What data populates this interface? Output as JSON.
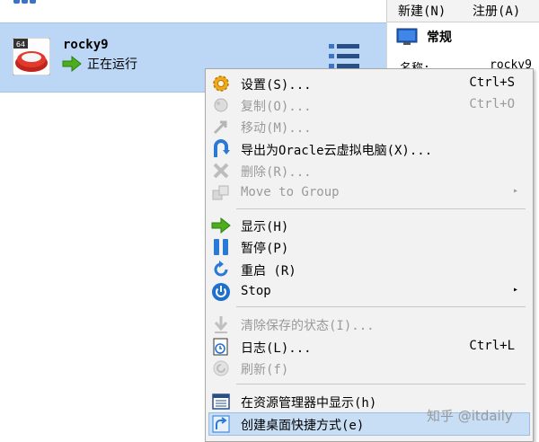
{
  "toolbar": {
    "new_label": "新建(N)",
    "register_label": "注册(A)"
  },
  "vm": {
    "name": "rocky9",
    "state": "正在运行",
    "os_badge": "64"
  },
  "details": {
    "section_title": "常规",
    "name_label": "名称:",
    "name_value": "rocky9"
  },
  "menu": {
    "items": [
      {
        "label": "设置(S)...",
        "shortcut": "Ctrl+S",
        "icon": "settings-gear-icon",
        "enabled": true
      },
      {
        "label": "复制(O)...",
        "shortcut": "Ctrl+O",
        "icon": "clone-sheep-icon",
        "enabled": false
      },
      {
        "label": "移动(M)...",
        "shortcut": "",
        "icon": "move-arrow-icon",
        "enabled": false
      },
      {
        "label": "导出为Oracle云虚拟电脑(X)...",
        "shortcut": "",
        "icon": "export-cloud-icon",
        "enabled": true
      },
      {
        "label": "删除(R)...",
        "shortcut": "",
        "icon": "delete-x-icon",
        "enabled": false
      },
      {
        "label": "Move to Group",
        "shortcut": "",
        "icon": "group-icon",
        "enabled": false,
        "submenu": true
      },
      {
        "label": "显示(H)",
        "shortcut": "",
        "icon": "show-arrow-icon",
        "enabled": true
      },
      {
        "label": "暂停(P)",
        "shortcut": "",
        "icon": "pause-icon",
        "enabled": true
      },
      {
        "label": "重启 (R)",
        "shortcut": "",
        "icon": "reset-icon",
        "enabled": true
      },
      {
        "label": "Stop",
        "shortcut": "",
        "icon": "power-icon",
        "enabled": true,
        "submenu": true
      },
      {
        "label": "清除保存的状态(I)...",
        "shortcut": "",
        "icon": "discard-state-icon",
        "enabled": false
      },
      {
        "label": "日志(L)...",
        "shortcut": "Ctrl+L",
        "icon": "log-icon",
        "enabled": true
      },
      {
        "label": "刷新(f)",
        "shortcut": "",
        "icon": "refresh-icon",
        "enabled": false
      },
      {
        "label": "在资源管理器中显示(h)",
        "shortcut": "",
        "icon": "file-manager-icon",
        "enabled": true
      },
      {
        "label": "创建桌面快捷方式(e)",
        "shortcut": "",
        "icon": "shortcut-icon",
        "enabled": true,
        "highlighted": true
      }
    ],
    "submenu_arrow": "▸"
  },
  "watermark": "知乎 @itdaily"
}
